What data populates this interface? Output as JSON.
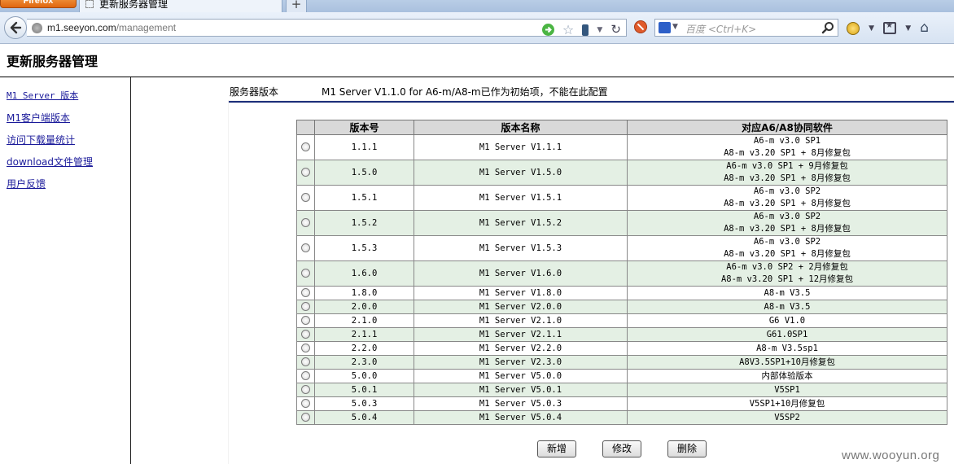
{
  "browser": {
    "app_button": "Firefox",
    "tab_title": "更新服务器管理",
    "new_tab_label": "+",
    "url_host": "m1.seeyon.com",
    "url_path": "/management",
    "search_placeholder": "百度 <Ctrl+K>"
  },
  "page": {
    "title": "更新服务器管理"
  },
  "sidebar": {
    "items": [
      {
        "label": "M1 Server 版本"
      },
      {
        "label": "M1客户端版本"
      },
      {
        "label": "访问下载量统计"
      },
      {
        "label": "download文件管理"
      },
      {
        "label": "用户反馈"
      }
    ]
  },
  "info": {
    "label": "服务器版本",
    "value": "M1 Server V1.1.0 for A6-m/A8-m已作为初始项，不能在此配置"
  },
  "table": {
    "headers": [
      "",
      "版本号",
      "版本名称",
      "对应A6/A8协同软件"
    ],
    "rows": [
      {
        "version": "1.1.1",
        "name": "M1 Server V1.1.1",
        "compat": [
          "A6-m v3.0 SP1",
          "A8-m v3.20 SP1 + 8月修复包"
        ]
      },
      {
        "version": "1.5.0",
        "name": "M1 Server V1.5.0",
        "compat": [
          "A6-m v3.0 SP1 + 9月修复包",
          "A8-m v3.20 SP1 + 8月修复包"
        ]
      },
      {
        "version": "1.5.1",
        "name": "M1 Server V1.5.1",
        "compat": [
          "A6-m v3.0 SP2",
          "A8-m v3.20 SP1 + 8月修复包"
        ]
      },
      {
        "version": "1.5.2",
        "name": "M1 Server V1.5.2",
        "compat": [
          "A6-m v3.0 SP2",
          "A8-m v3.20 SP1 + 8月修复包"
        ]
      },
      {
        "version": "1.5.3",
        "name": "M1 Server V1.5.3",
        "compat": [
          "A6-m v3.0 SP2",
          "A8-m v3.20 SP1 + 8月修复包"
        ]
      },
      {
        "version": "1.6.0",
        "name": "M1 Server V1.6.0",
        "compat": [
          "A6-m v3.0 SP2 + 2月修复包",
          "A8-m v3.20 SP1 + 12月修复包"
        ]
      },
      {
        "version": "1.8.0",
        "name": "M1 Server V1.8.0",
        "compat": [
          "A8-m V3.5"
        ]
      },
      {
        "version": "2.0.0",
        "name": "M1 Server V2.0.0",
        "compat": [
          "A8-m V3.5"
        ]
      },
      {
        "version": "2.1.0",
        "name": "M1 Server V2.1.0",
        "compat": [
          "G6 V1.0"
        ]
      },
      {
        "version": "2.1.1",
        "name": "M1 Server V2.1.1",
        "compat": [
          "G61.0SP1"
        ]
      },
      {
        "version": "2.2.0",
        "name": "M1 Server V2.2.0",
        "compat": [
          "A8-m V3.5sp1"
        ]
      },
      {
        "version": "2.3.0",
        "name": "M1 Server V2.3.0",
        "compat": [
          "A8V3.5SP1+10月修复包"
        ]
      },
      {
        "version": "5.0.0",
        "name": "M1 Server V5.0.0",
        "compat": [
          "内部体验版本"
        ]
      },
      {
        "version": "5.0.1",
        "name": "M1 Server V5.0.1",
        "compat": [
          "V5SP1"
        ]
      },
      {
        "version": "5.0.3",
        "name": "M1 Server V5.0.3",
        "compat": [
          "V5SP1+10月修复包"
        ]
      },
      {
        "version": "5.0.4",
        "name": "M1 Server V5.0.4",
        "compat": [
          "V5SP2"
        ]
      }
    ]
  },
  "buttons": {
    "add": "新增",
    "edit": "修改",
    "delete": "删除"
  },
  "watermark": "www.wooyun.org"
}
